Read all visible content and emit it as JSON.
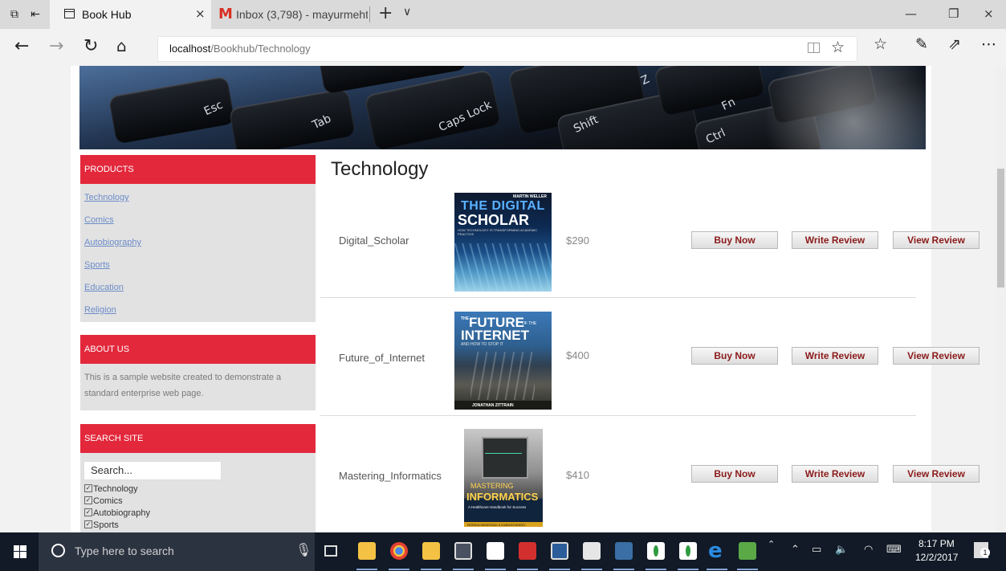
{
  "browser": {
    "active_tab": {
      "title": "Book Hub",
      "close": "×"
    },
    "tab2": {
      "title": "Inbox (3,798) - mayurmehta",
      "icon": "M"
    },
    "new_tab": "+",
    "tab_list": "∨",
    "window": {
      "minimize": "—",
      "restore": "❐",
      "close": "×"
    },
    "url": {
      "host": "localhost",
      "path": "/Bookhub/Technology"
    }
  },
  "sidebar": {
    "products": {
      "title": "PRODUCTS",
      "items": [
        {
          "label": "Technology"
        },
        {
          "label": "Comics"
        },
        {
          "label": "Autobiography"
        },
        {
          "label": "Sports"
        },
        {
          "label": "Education"
        },
        {
          "label": "Religion"
        }
      ]
    },
    "about": {
      "title": "ABOUT US",
      "text": "This is a sample website created to demonstrate a standard enterprise web page."
    },
    "search": {
      "title": "SEARCH SITE",
      "placeholder": "Search...",
      "filters": [
        {
          "label": "Technology",
          "checked": true
        },
        {
          "label": "Comics",
          "checked": true
        },
        {
          "label": "Autobiography",
          "checked": true
        },
        {
          "label": "Sports",
          "checked": true
        }
      ]
    }
  },
  "main": {
    "heading": "Technology",
    "buttons": {
      "buy": "Buy Now",
      "write": "Write Review",
      "view": "View Review"
    },
    "products": [
      {
        "name": "Digital_Scholar",
        "price": "$290",
        "cover": {
          "author": "MARTIN WELLER",
          "title_a": "THE DIGITAL",
          "title_b": "SCHOLAR",
          "subtitle": "HOW TECHNOLOGY IS TRANSFORMING ACADEMIC PRACTICE"
        }
      },
      {
        "name": "Future_of_Internet",
        "price": "$400",
        "cover": {
          "title_a": "FUTURE",
          "title_b": "INTERNET",
          "small": "THE",
          "of": "OF THE",
          "subtitle": "AND HOW TO STOP IT",
          "author": "JONATHAN ZITTRAIN"
        }
      },
      {
        "name": "Mastering_Informatics",
        "price": "$410",
        "cover": {
          "title_a": "MASTERING",
          "title_b": "INFORMATICS",
          "subtitle": "A Healthcare Handbook for Success",
          "author": "PATRICIA SENGSTACK & CHARLES BOICEY"
        }
      }
    ]
  },
  "taskbar": {
    "search_placeholder": "Type here to search",
    "time": "8:17 PM",
    "date": "12/2/2017",
    "notification_count": "1"
  },
  "colors": {
    "accent_red": "#e3283c",
    "link": "#6c8cc8",
    "button_text": "#8b1a1a"
  }
}
